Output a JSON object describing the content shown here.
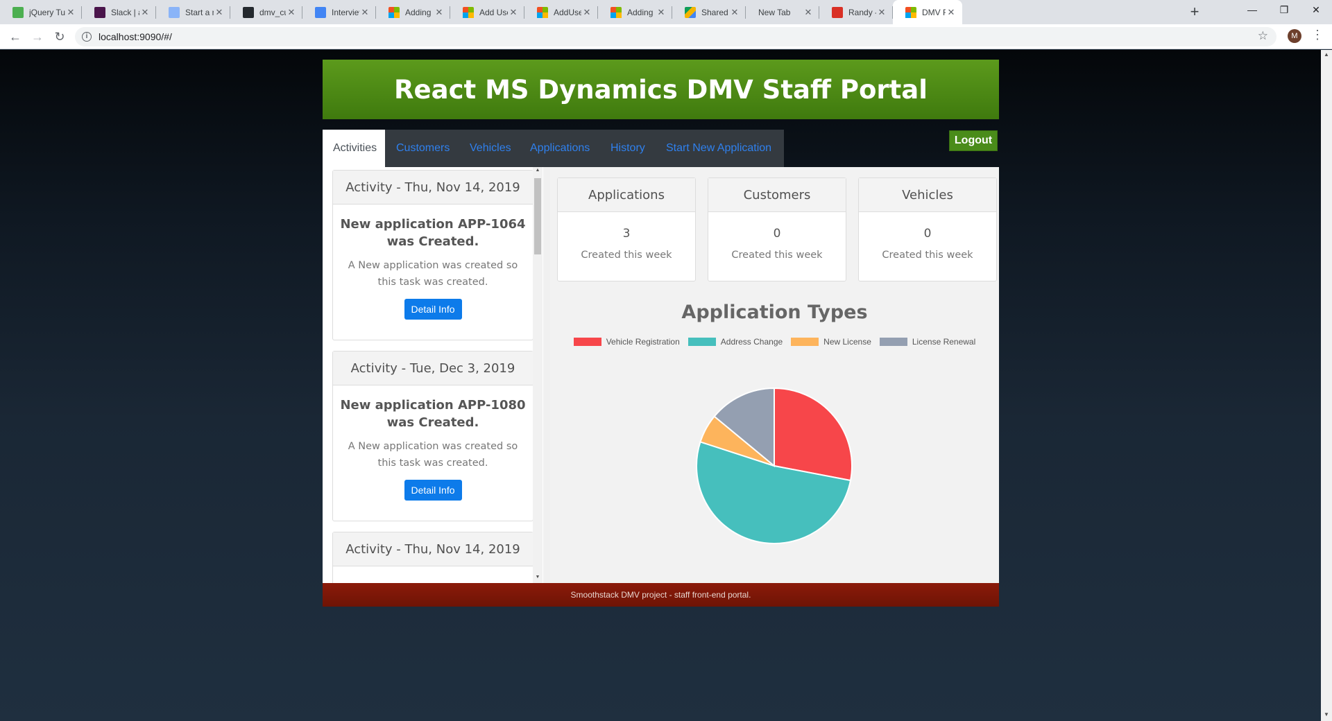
{
  "browser": {
    "tabs": [
      {
        "title": "jQuery Tuto",
        "favicon": "fav-green"
      },
      {
        "title": "Slack | augu",
        "favicon": "fav-slack"
      },
      {
        "title": "Start a new",
        "favicon": "fav-person"
      },
      {
        "title": "dmv_custom",
        "favicon": "fav-gh"
      },
      {
        "title": "Interview qu",
        "favicon": "fav-doc"
      },
      {
        "title": "Adding user",
        "favicon": "fav-ms"
      },
      {
        "title": "Add Users tc",
        "favicon": "fav-ms"
      },
      {
        "title": "AddUserToR",
        "favicon": "fav-ms"
      },
      {
        "title": "Adding user",
        "favicon": "fav-ms"
      },
      {
        "title": "Shared with",
        "favicon": "fav-drive"
      },
      {
        "title": "New Tab",
        "favicon": ""
      },
      {
        "title": "Randy -",
        "favicon": "fav-sound"
      },
      {
        "title": "DMV Front",
        "favicon": "fav-ms"
      }
    ],
    "active_tab_index": 12,
    "url": "localhost:9090/#/",
    "profile_initial": "M"
  },
  "header": {
    "title": "React MS Dynamics DMV Staff Portal"
  },
  "nav": {
    "tabs": [
      "Activities",
      "Customers",
      "Vehicles",
      "Applications",
      "History",
      "Start New Application"
    ],
    "active": "Activities",
    "logout_label": "Logout"
  },
  "activities": [
    {
      "header": "Activity - Thu, Nov 14, 2019",
      "title": "New application APP-1064 was Created.",
      "text": "A New application was created so this task was created.",
      "button": "Detail Info"
    },
    {
      "header": "Activity - Tue, Dec 3, 2019",
      "title": "New application APP-1080 was Created.",
      "text": "A New application was created so this task was created.",
      "button": "Detail Info"
    },
    {
      "header": "Activity - Thu, Nov 14, 2019",
      "title": "",
      "text": "",
      "button": ""
    }
  ],
  "stats": [
    {
      "label": "Applications",
      "value": "3",
      "sub": "Created this week"
    },
    {
      "label": "Customers",
      "value": "0",
      "sub": "Created this week"
    },
    {
      "label": "Vehicles",
      "value": "0",
      "sub": "Created this week"
    }
  ],
  "chart_data": {
    "type": "pie",
    "title": "Application Types",
    "legend_position": "top",
    "slices": [
      {
        "label": "Vehicle Registration",
        "value": 28,
        "color": "#f7464a"
      },
      {
        "label": "Address Change",
        "value": 52,
        "color": "#46bfbd"
      },
      {
        "label": "New License",
        "value": 6,
        "color": "#fdb45c"
      },
      {
        "label": "License Renewal",
        "value": 14,
        "color": "#949fb1"
      }
    ]
  },
  "footer": {
    "text": "Smoothstack DMV project - staff front-end portal."
  }
}
